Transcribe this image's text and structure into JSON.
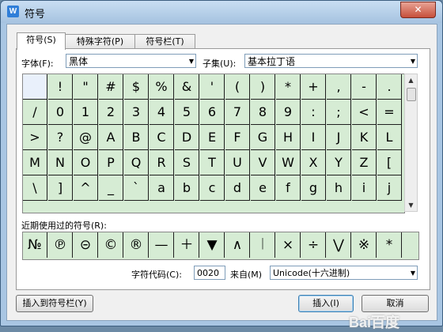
{
  "window": {
    "title": "符号",
    "app_icon_letter": "W",
    "close_label": "✕"
  },
  "tabs": [
    {
      "label": "符号(S)"
    },
    {
      "label": "特殊字符(P)"
    },
    {
      "label": "符号栏(T)"
    }
  ],
  "font": {
    "label": "字体(F):",
    "value": "黑体"
  },
  "subset": {
    "label": "子集(U):",
    "value": "基本拉丁语"
  },
  "symbols": [
    [
      "",
      "!",
      "\"",
      "#",
      "$",
      "%",
      "&",
      "'",
      "(",
      ")",
      "*",
      "+",
      ",",
      "-",
      "."
    ],
    [
      "/",
      "0",
      "1",
      "2",
      "3",
      "4",
      "5",
      "6",
      "7",
      "8",
      "9",
      ":",
      ";",
      "<",
      "="
    ],
    [
      ">",
      "?",
      "@",
      "A",
      "B",
      "C",
      "D",
      "E",
      "F",
      "G",
      "H",
      "I",
      "J",
      "K",
      "L"
    ],
    [
      "M",
      "N",
      "O",
      "P",
      "Q",
      "R",
      "S",
      "T",
      "U",
      "V",
      "W",
      "X",
      "Y",
      "Z",
      "["
    ],
    [
      "\\",
      "]",
      "^",
      "_",
      "`",
      "a",
      "b",
      "c",
      "d",
      "e",
      "f",
      "g",
      "h",
      "i",
      "j"
    ]
  ],
  "recent": {
    "label": "近期使用过的符号(R):",
    "items": [
      "№",
      "℗",
      "⊝",
      "©",
      "®",
      "—",
      "＋",
      "▼",
      "∧",
      "︱",
      "×",
      "÷",
      "⋁",
      "※",
      "*"
    ]
  },
  "char_code": {
    "label": "字符代码(C):",
    "value": "0020"
  },
  "from": {
    "label": "来自(M)",
    "value": "Unicode(十六进制)"
  },
  "buttons": {
    "insert_to_bar": "插入到符号栏(Y)",
    "insert": "插入(I)",
    "cancel": "取消"
  },
  "watermark": "Bai百度"
}
